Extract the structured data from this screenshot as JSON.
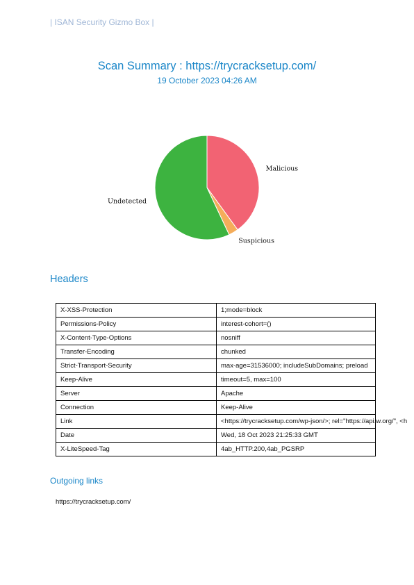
{
  "brand": "| ISAN Security Gizmo Box |",
  "scan": {
    "title": "Scan Summary : https://trycracksetup.com/",
    "date": "19 October 2023 04:26 AM"
  },
  "chart_data": {
    "type": "pie",
    "labels": [
      "Malicious",
      "Suspicious",
      "Undetected"
    ],
    "values": [
      40,
      3,
      57
    ],
    "colors": [
      "#f26373",
      "#f5ad5a",
      "#3db340"
    ],
    "start": "top, clockwise"
  },
  "headers_section": {
    "heading": "Headers",
    "rows": [
      {
        "key": "X-XSS-Protection",
        "value": "1;mode=block"
      },
      {
        "key": "Permissions-Policy",
        "value": "interest-cohort=()"
      },
      {
        "key": "X-Content-Type-Options",
        "value": "nosniff"
      },
      {
        "key": "Transfer-Encoding",
        "value": "chunked"
      },
      {
        "key": "Strict-Transport-Security",
        "value": "max-age=31536000; includeSubDomains; preload"
      },
      {
        "key": "Keep-Alive",
        "value": "timeout=5, max=100"
      },
      {
        "key": "Server",
        "value": "Apache"
      },
      {
        "key": "Connection",
        "value": "Keep-Alive"
      },
      {
        "key": "Link",
        "value": "<https://trycracksetup.com/wp-json/>; rel=\"https://api.w.org/\", <h"
      },
      {
        "key": "Date",
        "value": "Wed, 18 Oct 2023 21:25:33 GMT"
      },
      {
        "key": "X-LiteSpeed-Tag",
        "value": "4ab_HTTP.200,4ab_PGSRP"
      }
    ]
  },
  "outgoing": {
    "heading": "Outgoing links",
    "links": [
      "https://trycracksetup.com/"
    ]
  }
}
